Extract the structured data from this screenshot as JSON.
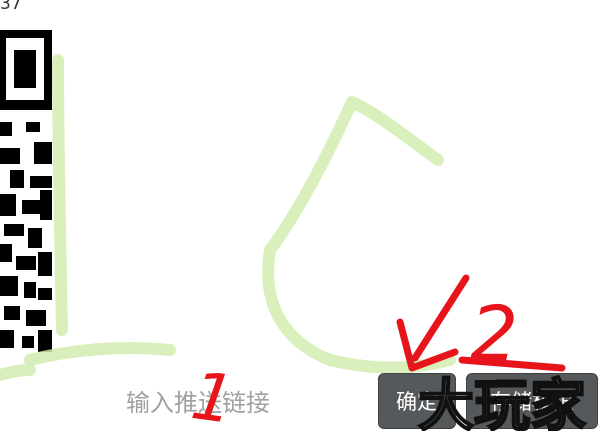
{
  "top_fragment": "37",
  "input": {
    "placeholder": "输入推送链接"
  },
  "buttons": {
    "confirm_label": "确定",
    "storage_label": "存储权限"
  },
  "annotations": {
    "step1": "1",
    "step2": "2",
    "watermark": "大玩家"
  },
  "colors": {
    "button_bg": "#55595c",
    "annotation_red": "#e8141c",
    "sketch_green": "#c8e89a"
  }
}
